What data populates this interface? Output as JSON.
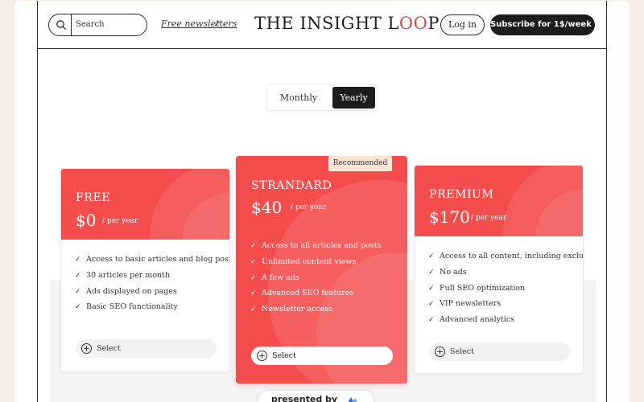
{
  "header": {
    "search_placeholder": "Search",
    "newsletters_link": "Free newsletters",
    "newsletters_arrow": "↗",
    "logo_main": "THE INSIGHT L",
    "logo_accent": "OO",
    "logo_tail": "P",
    "login_label": "Log in",
    "subscribe_label": "Subscribe for 1$/week ↗"
  },
  "billing_toggle": {
    "monthly_label": "Monthly",
    "yearly_label": "Yearly",
    "selected": "Yearly"
  },
  "plans": [
    {
      "name": "FREE",
      "price": "$0",
      "period": "/ per year",
      "features": [
        "Access to basic articles and blog posts",
        "30 articles per month",
        "Ads displayed on pages",
        "Basic SEO functionality"
      ],
      "select_label": "Select"
    },
    {
      "name": "STRANDARD",
      "badge": "Recommended",
      "price": "$40",
      "period": "/ per year",
      "features": [
        "Access to all articles and posts",
        "Unlimited content views",
        "A few ads",
        "Advanced SEO features",
        "Newsletter access"
      ],
      "select_label": "Select"
    },
    {
      "name": "PREMIUM",
      "price": "$170",
      "period": "/ per year",
      "features": [
        "Access to all content, including exclusives",
        "No ads",
        "Full SEO optimization",
        "VIP newsletters",
        "Advanced analytics"
      ],
      "select_label": "Select"
    }
  ],
  "footer_badge": {
    "label": "presented by"
  },
  "check_glyph": "✓",
  "plus_glyph": "+",
  "colors": {
    "accent_red": "#f54d4d",
    "dark": "#1c1c1c",
    "badge_bg": "#fbe3d6"
  }
}
